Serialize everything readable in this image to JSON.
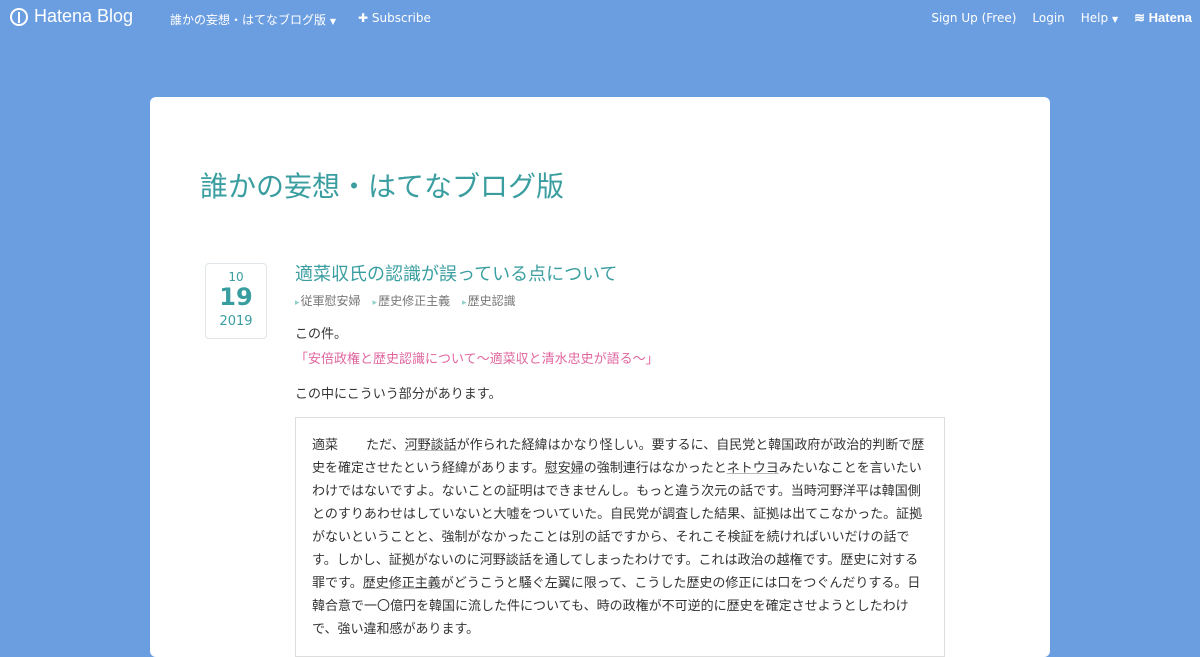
{
  "topbar": {
    "brand": "Hatena Blog",
    "blog_menu": "誰かの妄想・はてなブログ版",
    "subscribe": "Subscribe",
    "signup": "Sign Up (Free)",
    "login": "Login",
    "help": "Help",
    "hatena": "Hatena"
  },
  "blog": {
    "title": "誰かの妄想・はてなブログ版"
  },
  "entry": {
    "date": {
      "month": "10",
      "day": "19",
      "year": "2019"
    },
    "title": "適菜収氏の認識が誤っている点について",
    "categories": [
      "従軍慰安婦",
      "歴史修正主義",
      "歴史認識"
    ],
    "intro": "この件。",
    "link": "「安倍政権と歴史認識について～適菜収と清水忠史が語る～」",
    "para2": "この中にこういう部分があります。",
    "quote": {
      "speaker": "適菜",
      "s1": "ただ、",
      "k1": "河野談話",
      "s2": "が作られた経緯はかなり怪しい。要するに、自民党と韓国政府が政治的判断で歴史を確定させたという経緯があります。",
      "k2": "慰安婦",
      "s3": "の強制連行はなかったと",
      "k3": "ネトウヨ",
      "s4": "みたいなことを言いたいわけではないですよ。ないことの証明はできませんし。もっと違う次元の話です。当時河野洋平は韓国側とのすりあわせはしていないと大嘘をついていた。自民党が調査した結果、証拠は出てこなかった。証拠がないということと、強制がなかったことは別の話ですから、それこそ検証を続ければいいだけの話です。しかし、証拠がないのに河野談話を通してしまったわけです。これは政治の越権です。歴史に対する罪です。",
      "k4": "歴史修正主義",
      "s5": "がどうこうと騒ぐ左翼に限って、こうした歴史の修正には口をつぐんだりする。日韓合意で一〇億円を韓国に流した件についても、時の政権が不可逆的に歴史を確定させようとしたわけで、強い違和感があります。"
    }
  }
}
